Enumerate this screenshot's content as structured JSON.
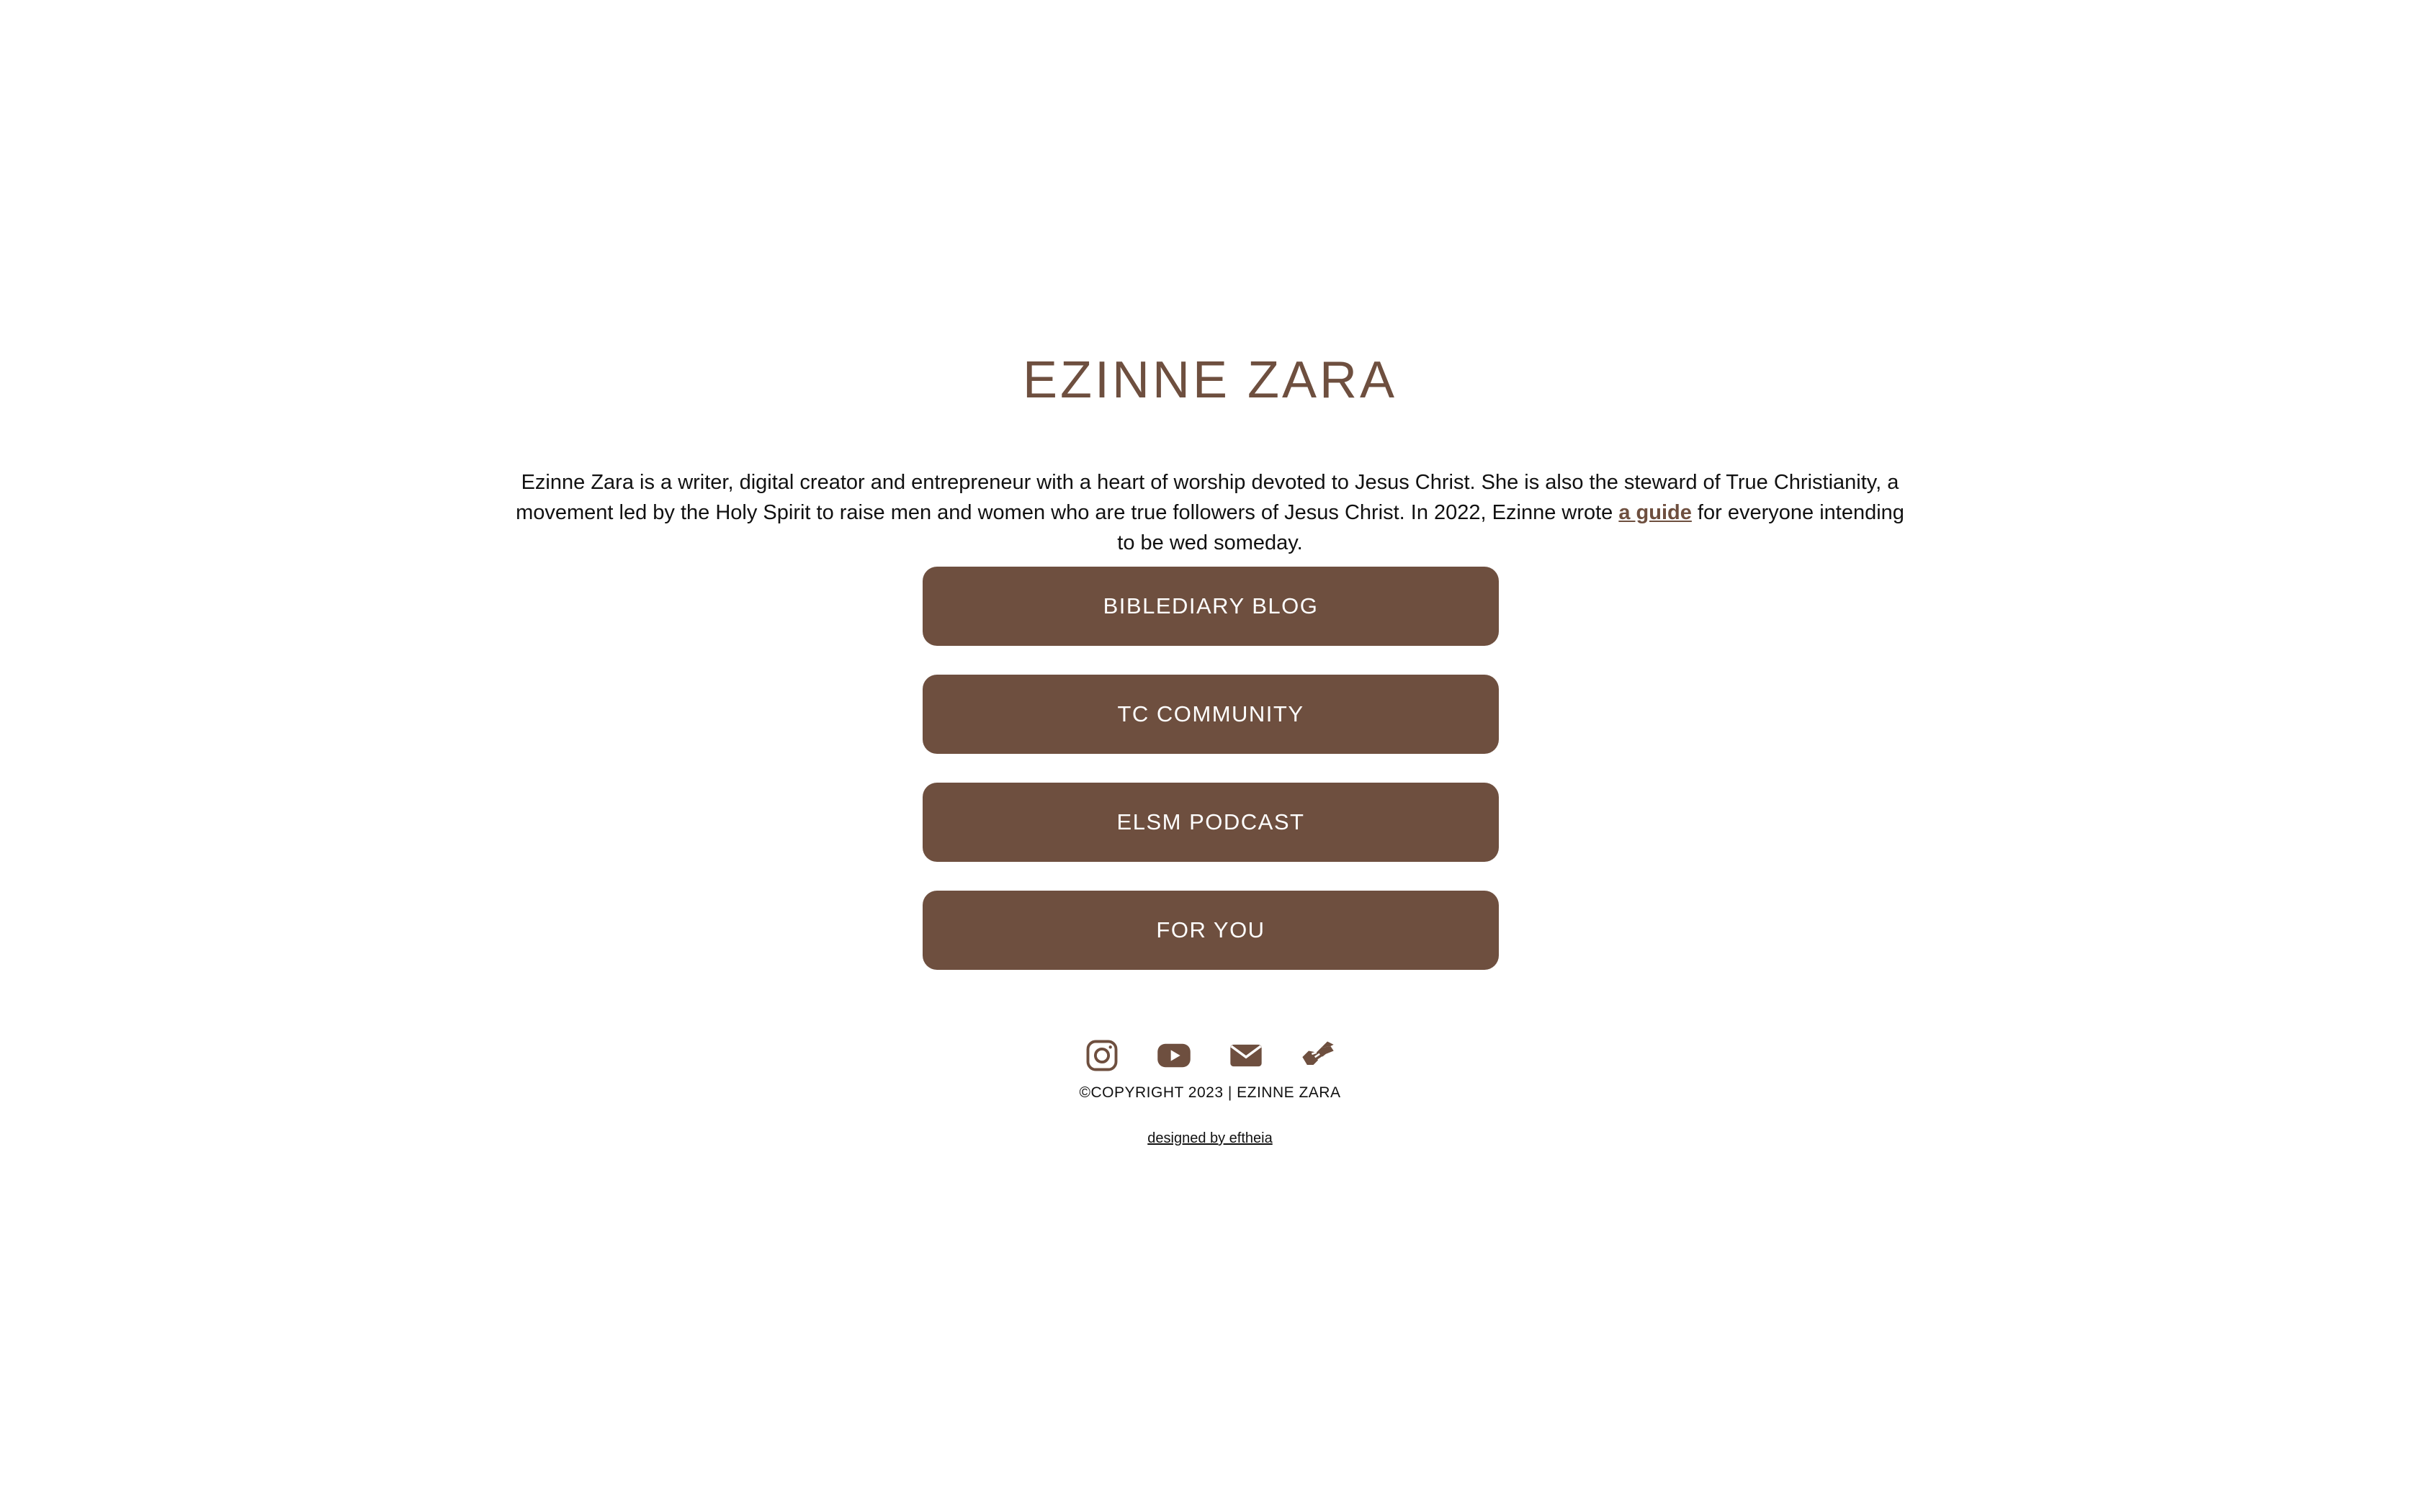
{
  "header": {
    "title": "EZINNE ZARA"
  },
  "intro": {
    "text_before_link": "Ezinne Zara is a writer, digital creator and entrepreneur with a heart of worship devoted to Jesus Christ. She is also the steward of True Christianity, a movement led by the Holy Spirit to raise men and women who are true followers of Jesus Christ. In 2022, Ezinne wrote ",
    "link_text": "a guide",
    "text_after_link": " for everyone intending to be wed someday."
  },
  "buttons": [
    {
      "label": "BIBLEDIARY BLOG"
    },
    {
      "label": "TC COMMUNITY"
    },
    {
      "label": "ELSM PODCAST"
    },
    {
      "label": "FOR YOU"
    }
  ],
  "social": {
    "icons": [
      "instagram-icon",
      "youtube-icon",
      "envelope-icon",
      "handshake-icon"
    ]
  },
  "footer": {
    "copyright": "©COPYRIGHT 2023 | EZINNE ZARA",
    "designed_by": "designed by eftheia"
  },
  "colors": {
    "brand": "#6e4f3f",
    "background": "#ffffff",
    "text": "#111111"
  }
}
